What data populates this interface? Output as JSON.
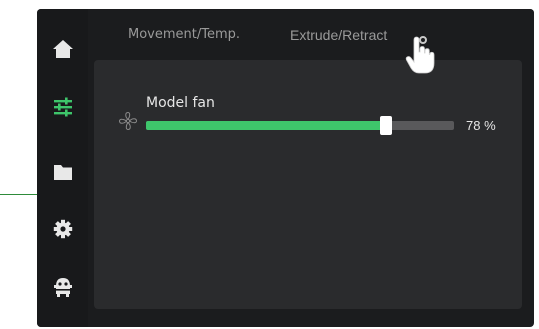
{
  "sidebar": {
    "items": [
      {
        "icon": "home-icon",
        "active": false
      },
      {
        "icon": "sliders-icon",
        "active": true
      },
      {
        "icon": "folder-icon",
        "active": false
      },
      {
        "icon": "gear-icon",
        "active": false
      },
      {
        "icon": "robot-icon",
        "active": false
      }
    ]
  },
  "tabs": [
    {
      "label": "Movement/Temp."
    },
    {
      "label": "Extrude/Retract"
    }
  ],
  "fan": {
    "label": "Model fan",
    "value_text": "78 %",
    "value": 0.78,
    "icon": "fan-icon"
  },
  "colors": {
    "accent": "#3ec56b",
    "background": "#1b1c1e",
    "panel": "#2a2b2d",
    "track": "#59595b"
  }
}
